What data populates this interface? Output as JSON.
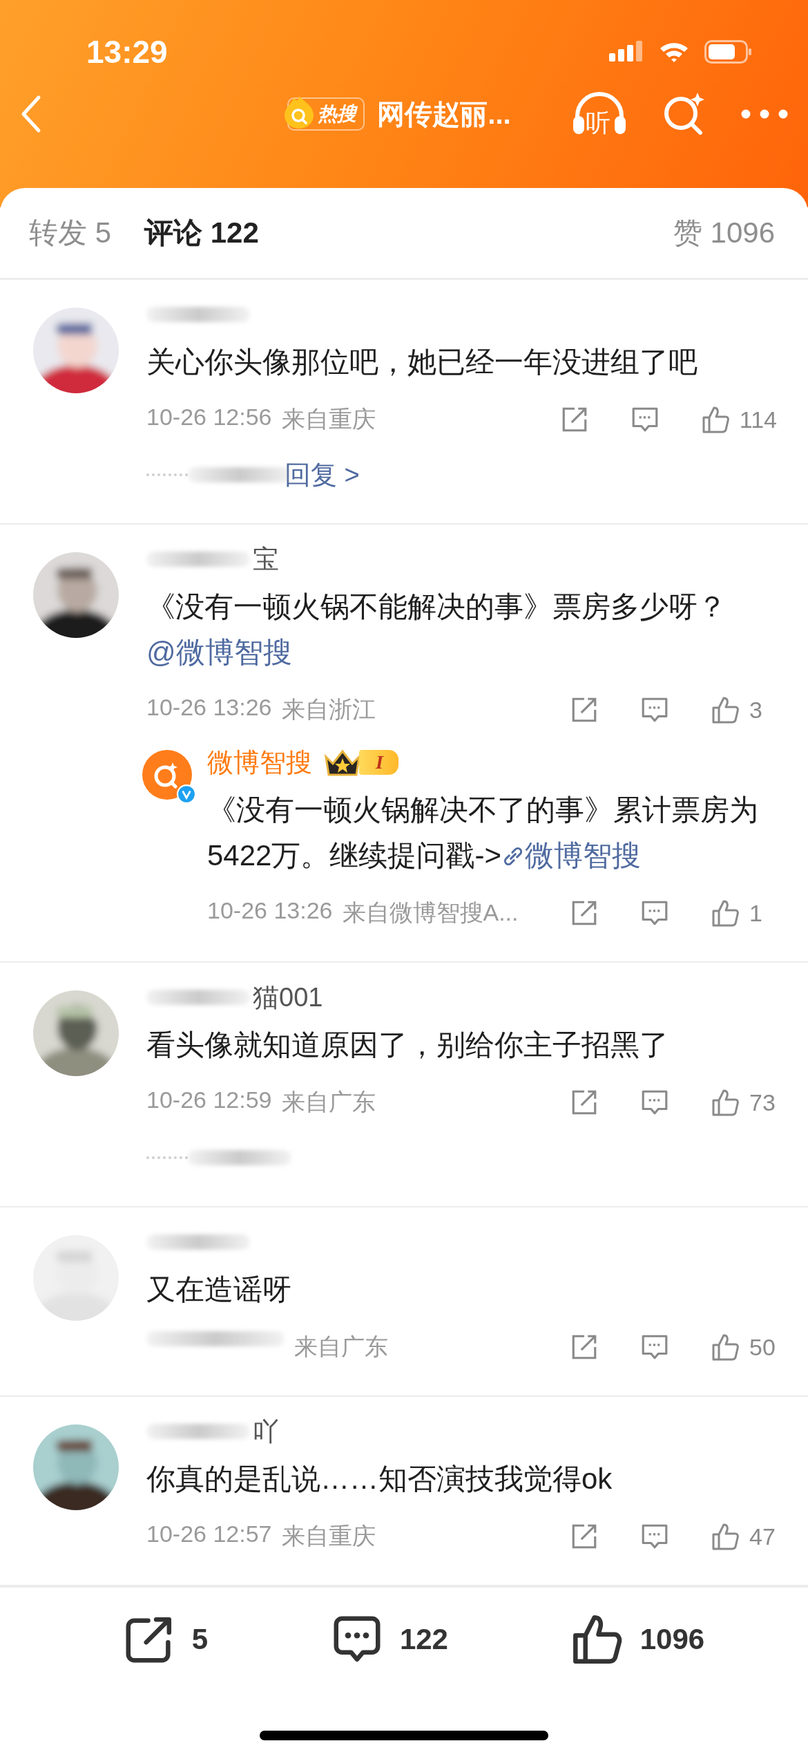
{
  "status_bar": {
    "time": "13:29"
  },
  "nav": {
    "badge": "热搜",
    "title": "网传赵丽...",
    "listen": "听"
  },
  "tabs": [
    {
      "label": "转发 5",
      "selected": false
    },
    {
      "label": "评论 122",
      "selected": true
    }
  ],
  "likes_tab": "赞 1096",
  "comments": [
    {
      "avatar": {
        "kind": "picture"
      },
      "segments": [
        {
          "kind": "plain",
          "text": "关心你头像那位吧，她已经一年没进组了吧"
        }
      ],
      "date": "10-26 12:56",
      "location": "来自重庆",
      "likes": "114",
      "more_replies": {
        "kind": "link",
        "text": "回复 >"
      }
    },
    {
      "avatar": {
        "kind": "picture"
      },
      "name": "宝",
      "segments": [
        {
          "kind": "plain",
          "text": "《没有一顿火锅不能解决的事》票房多少呀？"
        },
        {
          "kind": "mention",
          "text": "@微博智搜"
        }
      ],
      "date": "10-26 13:26",
      "location": "来自浙江",
      "likes": "3",
      "children": [
        {
          "avatar": {
            "kind": "logo",
            "verified": true
          },
          "vip": true,
          "name": "微博智搜",
          "level": "I",
          "segments": [
            {
              "kind": "plain",
              "text": "《没有一顿火锅解决不了的事》累计票房为 5422万。继续提问戳->"
            },
            {
              "kind": "link",
              "text": "微博智搜"
            }
          ],
          "date": "10-26 13:26",
          "location": "来自微博智搜A...",
          "likes": "1"
        }
      ]
    },
    {
      "avatar": {
        "kind": "picture"
      },
      "name": "猫001",
      "segments": [
        {
          "kind": "plain",
          "text": "看头像就知道原因了，别给你主子招黑了"
        }
      ],
      "date": "10-26 12:59",
      "location": "来自广东",
      "likes": "73",
      "more_replies": {
        "kind": "blurred"
      }
    },
    {
      "avatar": {
        "kind": "picture"
      },
      "segments": [
        {
          "kind": "plain",
          "text": "又在造谣呀"
        }
      ],
      "location": "来自广东",
      "likes": "50"
    },
    {
      "avatar": {
        "kind": "picture"
      },
      "name": "吖",
      "segments": [
        {
          "kind": "plain",
          "text": "你真的是乱说……知否演技我觉得ok"
        }
      ],
      "date": "10-26 12:57",
      "location": "来自重庆",
      "likes": "47"
    }
  ],
  "bottom_bar": {
    "reposts": "5",
    "comments": "122",
    "likes": "1096"
  }
}
